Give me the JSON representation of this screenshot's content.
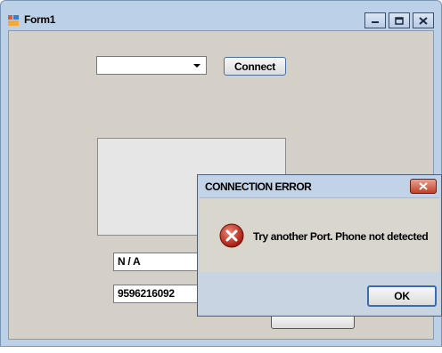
{
  "window": {
    "title": "Form1",
    "icon": "app-form-icon",
    "controls": {
      "minimize": "minimize-icon",
      "maximize": "maximize-icon",
      "close": "close-icon"
    }
  },
  "form": {
    "port_select_value": "",
    "connect_label": "Connect",
    "status_text": "N / A",
    "number_text": "9596216092"
  },
  "dialog": {
    "title": "CONNECTION ERROR",
    "message": "Try another Port. Phone not detected",
    "ok_label": "OK",
    "icon": "error-icon"
  },
  "colors": {
    "window_frame": "#bcd1e8",
    "client_bg": "#d4d0c8",
    "dialog_frame": "#c2d3e8",
    "error_red": "#c0392b"
  }
}
